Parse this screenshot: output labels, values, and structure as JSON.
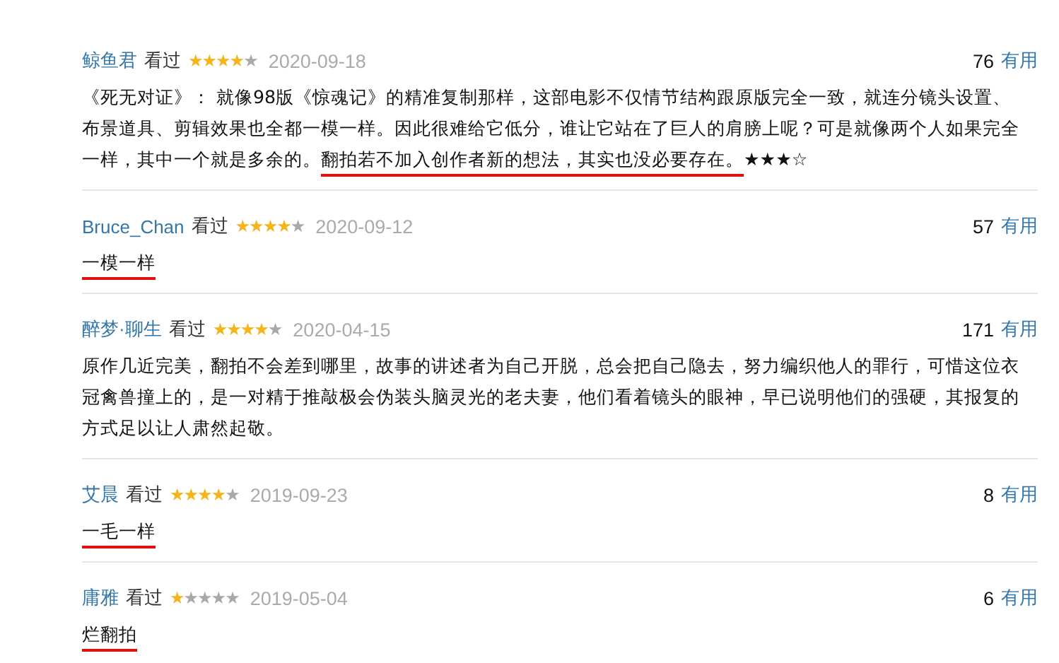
{
  "reviews": [
    {
      "user": "鲸鱼君",
      "watched": "看过",
      "stars": 4,
      "date": "2020-09-18",
      "votes": "76",
      "useful": "有用",
      "text": [
        {
          "t": "《死无对证》： 就像98版《惊魂记》的精准复制那样，这部电影不仅情节结构跟原版完全一致，就连分镜头设置、布景道具、剪辑效果也全都一模一样。因此很难给它低分，谁让它站在了巨人的肩膀上呢？可是就像两个人如果完全一样，其中一个就是多余的。",
          "underlined": false
        },
        {
          "t": "翻拍若不加入创作者新的想法，其实也没必要存在。",
          "underlined": true
        },
        {
          "t": "★★★☆",
          "underlined": false
        }
      ]
    },
    {
      "user": "Bruce_Chan",
      "watched": "看过",
      "stars": 4,
      "date": "2020-09-12",
      "votes": "57",
      "useful": "有用",
      "text": [
        {
          "t": "一模一样",
          "underlined": true
        }
      ]
    },
    {
      "user": "醉梦·聊生",
      "watched": "看过",
      "stars": 4,
      "date": "2020-04-15",
      "votes": "171",
      "useful": "有用",
      "text": [
        {
          "t": "原作几近完美，翻拍不会差到哪里，故事的讲述者为自己开脱，总会把自己隐去，努力编织他人的罪行，可惜这位衣冠禽兽撞上的，是一对精于推敲极会伪装头脑灵光的老夫妻，他们看着镜头的眼神，早已说明他们的强硬，其报复的方式足以让人肃然起敬。",
          "underlined": false
        }
      ]
    },
    {
      "user": "艾晨",
      "watched": "看过",
      "stars": 4,
      "date": "2019-09-23",
      "votes": "8",
      "useful": "有用",
      "text": [
        {
          "t": "一毛一样",
          "underlined": true
        }
      ]
    },
    {
      "user": "庸雅",
      "watched": "看过",
      "stars": 1,
      "date": "2019-05-04",
      "votes": "6",
      "useful": "有用",
      "text": [
        {
          "t": "烂翻拍",
          "underlined": true
        }
      ]
    }
  ]
}
